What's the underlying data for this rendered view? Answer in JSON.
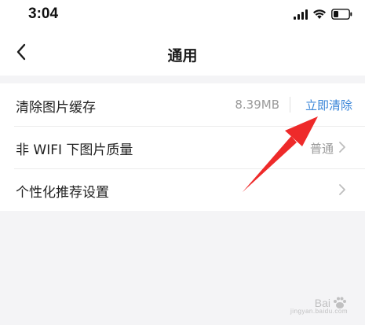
{
  "status_bar": {
    "time": "3:04",
    "icons": [
      "signal-icon",
      "wifi-icon",
      "battery-icon"
    ]
  },
  "header": {
    "title": "通用",
    "back_icon": "chevron-left-icon"
  },
  "settings": [
    {
      "label": "清除图片缓存",
      "value": "8.39MB",
      "action": "立即清除"
    },
    {
      "label": "非 WIFI 下图片质量",
      "value": "普通"
    },
    {
      "label": "个性化推荐设置"
    }
  ],
  "colors": {
    "accent": "#3a86d8",
    "arrow": "#ee2a2a",
    "background": "#f4f4f6",
    "value_text": "#9a9a9a"
  },
  "watermark": {
    "brand": "Bai",
    "sub": "jingyan.baidu.com"
  }
}
